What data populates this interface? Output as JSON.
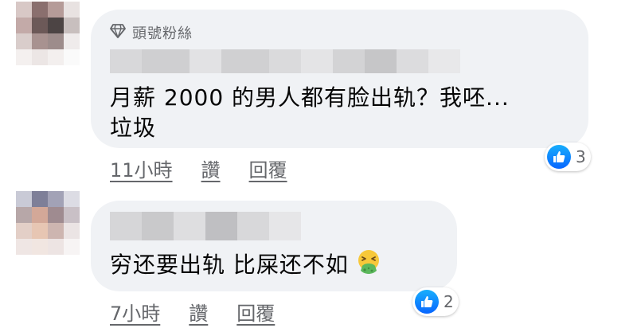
{
  "comments": [
    {
      "badge_label": "頭號粉絲",
      "text": "月薪 2000 的男人都有脸出轨？我呸...\n垃圾",
      "time": "11小時",
      "like_label": "讚",
      "reply_label": "回覆",
      "reaction_count": "3",
      "reaction_icon": "like-icon"
    },
    {
      "text": "穷还要出轨 比屎还不如",
      "emoji": "nauseated-face-emoji",
      "time": "7小時",
      "like_label": "讚",
      "reply_label": "回覆",
      "reaction_count": "2",
      "reaction_icon": "like-icon"
    }
  ],
  "colors": {
    "bubble": "#f0f2f5",
    "meta_text": "#65676b",
    "like_blue": "#0866ff"
  }
}
